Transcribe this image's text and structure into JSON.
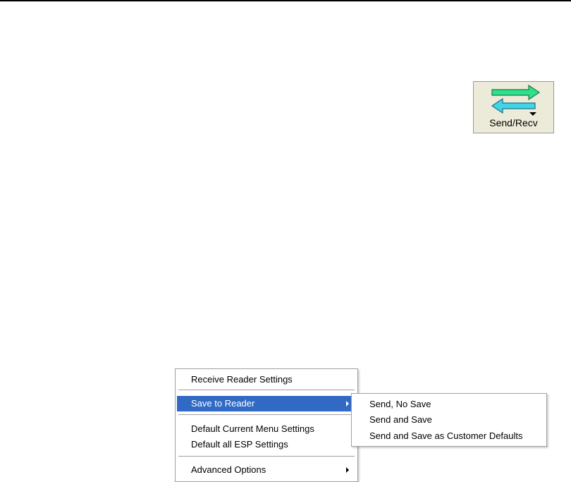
{
  "toolbar": {
    "send_recv_label": "Send/Recv"
  },
  "context_menu": {
    "items": [
      {
        "label": "Receive Reader Settings"
      },
      {
        "label": "Save to Reader",
        "has_submenu": true,
        "selected": true
      },
      {
        "label": "Default Current Menu Settings"
      },
      {
        "label": "Default all ESP Settings"
      },
      {
        "label": "Advanced Options",
        "has_submenu": true
      }
    ],
    "submenu": [
      {
        "label": "Send, No Save"
      },
      {
        "label": "Send and Save"
      },
      {
        "label": "Send and Save as Customer Defaults"
      }
    ]
  },
  "colors": {
    "selection": "#316ac5",
    "button_face": "#ecead8",
    "arrow_send": "#2ee08a",
    "arrow_receive": "#3fd6e6"
  }
}
